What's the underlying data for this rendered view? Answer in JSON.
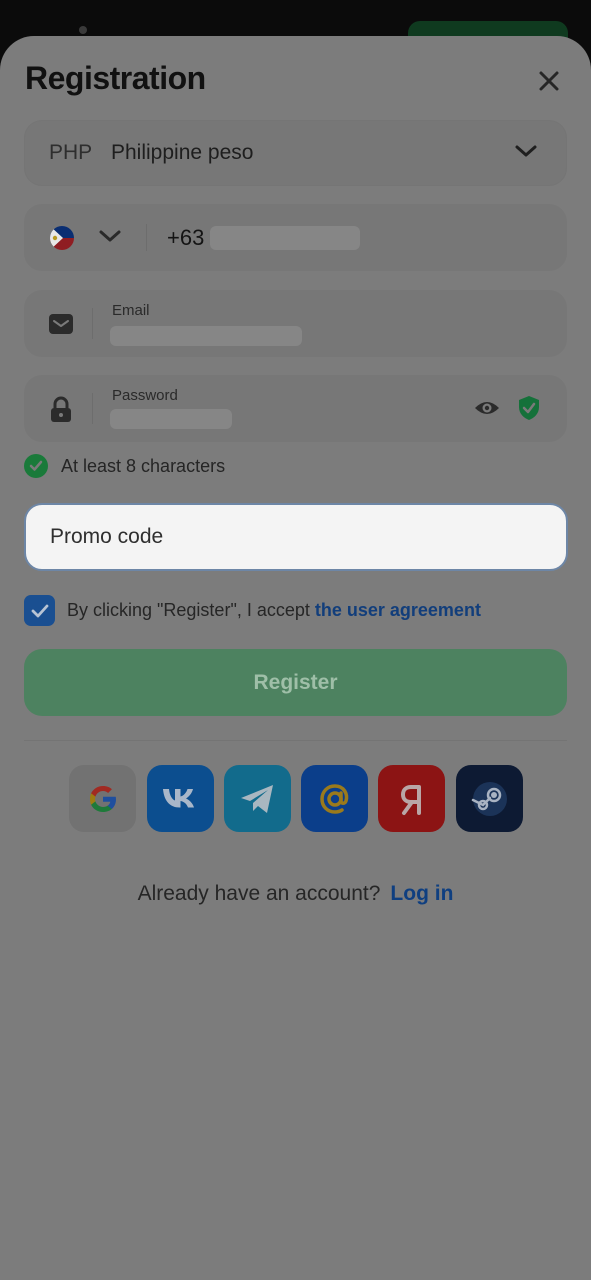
{
  "title": "Registration",
  "currency": {
    "code": "PHP",
    "name": "Philippine peso"
  },
  "phone": {
    "prefix": "+63",
    "country_icon": "philippines-flag-icon"
  },
  "email": {
    "label": "Email"
  },
  "password": {
    "label": "Password"
  },
  "hint": {
    "text": "At least 8 characters"
  },
  "promo": {
    "placeholder": "Promo code"
  },
  "agreement": {
    "text": "By clicking \"Register\", I accept ",
    "link": "the user agreement",
    "checked": true
  },
  "register": {
    "label": "Register"
  },
  "social": [
    "google-icon",
    "vk-icon",
    "telegram-icon",
    "mail-ru-icon",
    "yandex-icon",
    "steam-icon"
  ],
  "login": {
    "question": "Already have an account?",
    "link": "Log in"
  },
  "colors": {
    "accent_link": "#0f3f80",
    "register_bg": "#4d8260",
    "overlay": "#7c7c7c",
    "checkbox": "#1a4f91",
    "success": "#1a7a3a"
  }
}
